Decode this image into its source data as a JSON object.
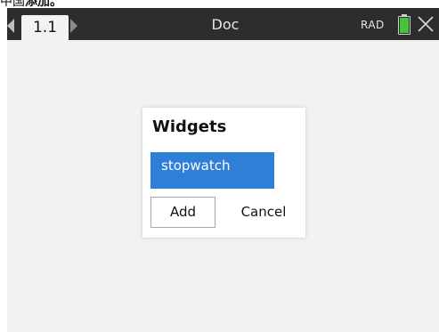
{
  "caption": {
    "prefix": "中国",
    "bold": "添加。"
  },
  "titlebar": {
    "tab_label": "1.1",
    "doc_title": "Doc",
    "angle_mode": "RAD",
    "battery_color": "#43c43c",
    "battery_level": 1.0,
    "icons": [
      "left-arrow",
      "right-arrow",
      "battery",
      "close-x"
    ]
  },
  "dialog": {
    "title": "Widgets",
    "items": [
      {
        "label": "stopwatch",
        "selected": true
      }
    ],
    "selected_color": "#2f7ed8",
    "add_label": "Add",
    "cancel_label": "Cancel"
  }
}
